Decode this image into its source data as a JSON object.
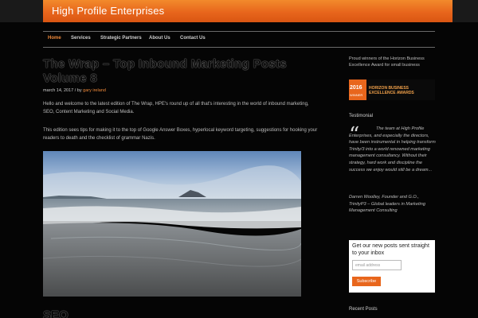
{
  "header": {
    "site_title": "High Profile Enterprises"
  },
  "nav": {
    "items": [
      "Home",
      "Services",
      "Strategic Partners",
      "About Us",
      "Contact Us"
    ]
  },
  "post": {
    "title": "The Wrap – Top Inbound Marketing Posts Volume 8",
    "date": "march 14, 2017 / by ",
    "author": "gary ireland",
    "p1": "Hello and welcome to the latest edition of The Wrap, HPE's round up of all that's interesting in the world of inbound marketing, SEO, Content Marketing and Social Media.",
    "p2": "This edition sees tips for making it to the top of Google Answer Boxes, hyperlocal keyword targeting, suggestions for hooking your readers to death and the checklist of grammar Nazis."
  },
  "post2": {
    "title": "SEO"
  },
  "sidebar": {
    "award_text": "Proud winners of the Horizon Business Excellence Award for small business",
    "badge_year": "2016",
    "badge_winner": "WINNER",
    "badge_line1": "HORIZON BUSINESS",
    "badge_line2": "EXCELLENCE AWARDS",
    "testimonial_heading": "Testimonial",
    "quote_mark": "“",
    "quote": "The team at High Profile Enterprises, and especially the directors, have been instrumental in helping transform Trinity/3 into a world renowned marketing management consultancy. Without their strategy, hard work and discipline the success we enjoy would still be a dream...",
    "quote_author": "Darren Woolley, Founder and G.O., TrinityP3 – Global leaders in Marketing Management Consulting",
    "subscribe_title": "Get our new posts sent straight to your inbox",
    "subscribe_placeholder": "email address",
    "subscribe_button": "Subscribe",
    "recent_posts": "Recent Posts"
  }
}
